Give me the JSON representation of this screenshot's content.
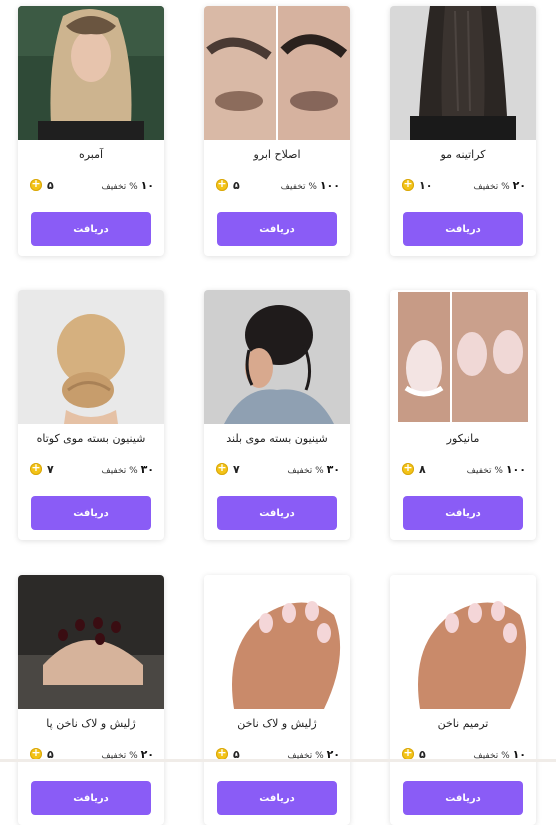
{
  "cards": [
    {
      "name": "کراتینه مو",
      "discount": "۲۰",
      "discount_label": "% تخفیف",
      "coins": "۱۰",
      "button": "دریافت"
    },
    {
      "name": "اصلاح ابرو",
      "discount": "۱۰۰",
      "discount_label": "% تخفیف",
      "coins": "۵",
      "button": "دریافت"
    },
    {
      "name": "آمبره",
      "discount": "۱۰",
      "discount_label": "% تخفیف",
      "coins": "۵",
      "button": "دریافت"
    },
    {
      "name": "مانیکور",
      "discount": "۱۰۰",
      "discount_label": "% تخفیف",
      "coins": "۸",
      "button": "دریافت"
    },
    {
      "name": "شینیون بسته موی بلند",
      "discount": "۳۰",
      "discount_label": "% تخفیف",
      "coins": "۷",
      "button": "دریافت"
    },
    {
      "name": "شینیون بسته موی کوتاه",
      "discount": "۳۰",
      "discount_label": "% تخفیف",
      "coins": "۷",
      "button": "دریافت"
    },
    {
      "name": "ترمیم ناخن",
      "discount": "۱۰",
      "discount_label": "% تخفیف",
      "coins": "۵",
      "button": "دریافت"
    },
    {
      "name": "ژلیش و لاک ناخن",
      "discount": "۲۰",
      "discount_label": "% تخفیف",
      "coins": "۵",
      "button": "دریافت"
    },
    {
      "name": "ژلیش و لاک ناخن پا",
      "discount": "۲۰",
      "discount_label": "% تخفیف",
      "coins": "۵",
      "button": "دریافت"
    }
  ]
}
